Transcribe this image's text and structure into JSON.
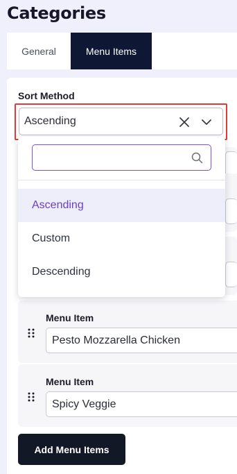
{
  "page": {
    "title": "Categories"
  },
  "tabs": [
    {
      "label": "General",
      "active": false
    },
    {
      "label": "Menu Items",
      "active": true
    }
  ],
  "sort": {
    "label": "Sort Method",
    "selected": "Ascending",
    "search_placeholder": "",
    "options": [
      {
        "label": "Ascending",
        "selected": true
      },
      {
        "label": "Custom",
        "selected": false
      },
      {
        "label": "Descending",
        "selected": false
      }
    ]
  },
  "menu_items": [
    {
      "label": "Menu Item",
      "value": "Pesto Mozzarella Chicken"
    },
    {
      "label": "Menu Item",
      "value": "Spicy Veggie"
    }
  ],
  "add_button": {
    "label": "Add Menu Items"
  },
  "colors": {
    "accent": "#6a3fc8",
    "active_tab": "#0e1733",
    "button": "#131827",
    "highlight": "#e23a3a"
  },
  "icons": [
    "clear-icon",
    "chevron-down-icon",
    "search-icon",
    "drag-handle-icon"
  ]
}
